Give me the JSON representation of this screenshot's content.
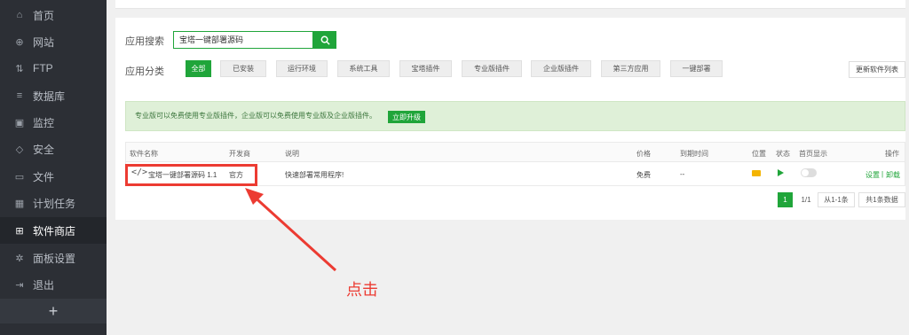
{
  "sidebar": {
    "items": [
      {
        "label": "首页",
        "icon": "home-icon",
        "glyph": "⌂"
      },
      {
        "label": "网站",
        "icon": "globe-icon",
        "glyph": "⊕"
      },
      {
        "label": "FTP",
        "icon": "ftp-icon",
        "glyph": "⇅"
      },
      {
        "label": "数据库",
        "icon": "database-icon",
        "glyph": "≡"
      },
      {
        "label": "监控",
        "icon": "monitor-icon",
        "glyph": "▣"
      },
      {
        "label": "安全",
        "icon": "shield-icon",
        "glyph": "◇"
      },
      {
        "label": "文件",
        "icon": "folder-icon",
        "glyph": "▭"
      },
      {
        "label": "计划任务",
        "icon": "calendar-icon",
        "glyph": "▦"
      },
      {
        "label": "软件商店",
        "icon": "apps-icon",
        "glyph": "⊞"
      },
      {
        "label": "面板设置",
        "icon": "gear-icon",
        "glyph": "✲"
      },
      {
        "label": "退出",
        "icon": "logout-icon",
        "glyph": "⇥"
      }
    ],
    "active_index": 8,
    "add_label": "+"
  },
  "search": {
    "label": "应用搜索",
    "value": "宝塔一键部署源码"
  },
  "categories": {
    "label": "应用分类",
    "items": [
      "全部",
      "已安装",
      "运行环境",
      "系统工具",
      "宝塔插件",
      "专业版插件",
      "企业版插件",
      "第三方应用",
      "一键部署"
    ],
    "active": "全部"
  },
  "refresh_label": "更新软件列表",
  "notice": {
    "text": "专业版可以免费使用专业版插件，企业版可以免费使用专业版及企业版插件。",
    "button": "立即升级"
  },
  "table": {
    "headers": {
      "name": "软件名称",
      "developer": "开发商",
      "desc": "说明",
      "price": "价格",
      "expire": "到期时间",
      "location": "位置",
      "status": "状态",
      "homepage": "首页显示",
      "ops": "操作"
    },
    "rows": [
      {
        "name": "宝塔一键部署源码 1.1",
        "developer": "官方",
        "desc": "快速部署常用程序!",
        "price": "免费",
        "expire": "--",
        "op_settings": "设置",
        "op_sep": "|",
        "op_uninstall": "卸载"
      }
    ]
  },
  "pagination": {
    "current": "1",
    "pages": "1/1",
    "range": "从1-1条",
    "total": "共1条数据"
  },
  "annotation": {
    "text": "点击",
    "color": "#ec3b32"
  },
  "colors": {
    "accent": "#20a53a",
    "sidebar_bg": "#2c2f35"
  }
}
